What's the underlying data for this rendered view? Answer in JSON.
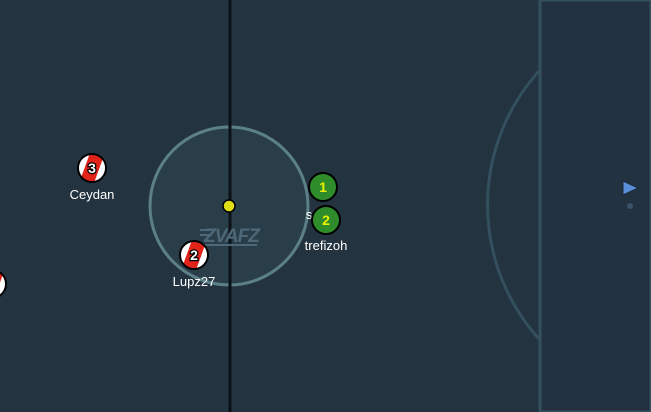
{
  "game": {
    "pitch_color": "#233340",
    "line_color": "#34505f",
    "center_circle_color": "#5c8087",
    "logo_text": "ZVAFZ",
    "teams": {
      "red": {
        "fill": "#ffffff",
        "stripe": "#e2231a",
        "number_color": "#ffffff"
      },
      "green": {
        "fill": "#2f8c2a",
        "number_color": "#e8f200"
      }
    },
    "players": [
      {
        "id": "ceydan",
        "team": "red",
        "number": "3",
        "name": "Ceydan"
      },
      {
        "id": "lupz27",
        "team": "red",
        "number": "2",
        "name": "Lupz27"
      },
      {
        "id": "edge",
        "team": "red",
        "number": "",
        "name": ""
      },
      {
        "id": "green1",
        "team": "green",
        "number": "1",
        "name": "s"
      },
      {
        "id": "trefizoh",
        "team": "green",
        "number": "2",
        "name": "trefizoh"
      }
    ],
    "ball_color": "#dede17",
    "offscreen_indicator_color": "#5b8fd8"
  }
}
